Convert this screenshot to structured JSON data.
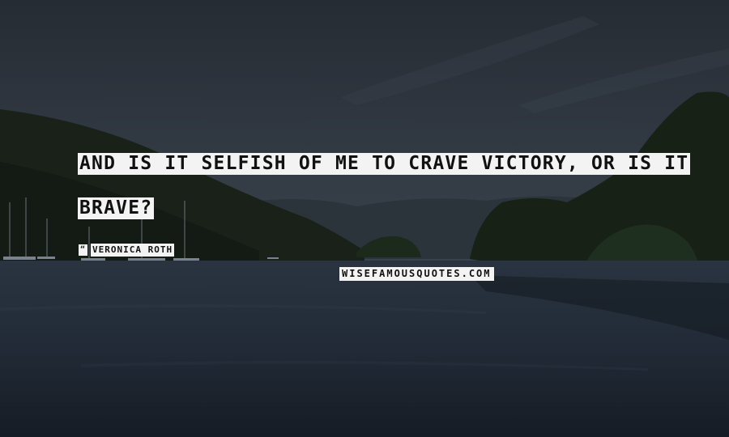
{
  "quote": {
    "line1": "AND IS IT SELFISH OF ME TO CRAVE VICTORY, OR IS IT",
    "line2": "BRAVE?"
  },
  "author": {
    "icon": "quote-mark-icon",
    "icon_glyph": "“",
    "name": "VERONICA ROTH"
  },
  "watermark": {
    "text": "WISEFAMOUSQUOTES.COM"
  },
  "colors": {
    "sky": "#2a3038",
    "water": "#1f2833",
    "highlight": "#f3f3f3",
    "text": "#111111"
  }
}
